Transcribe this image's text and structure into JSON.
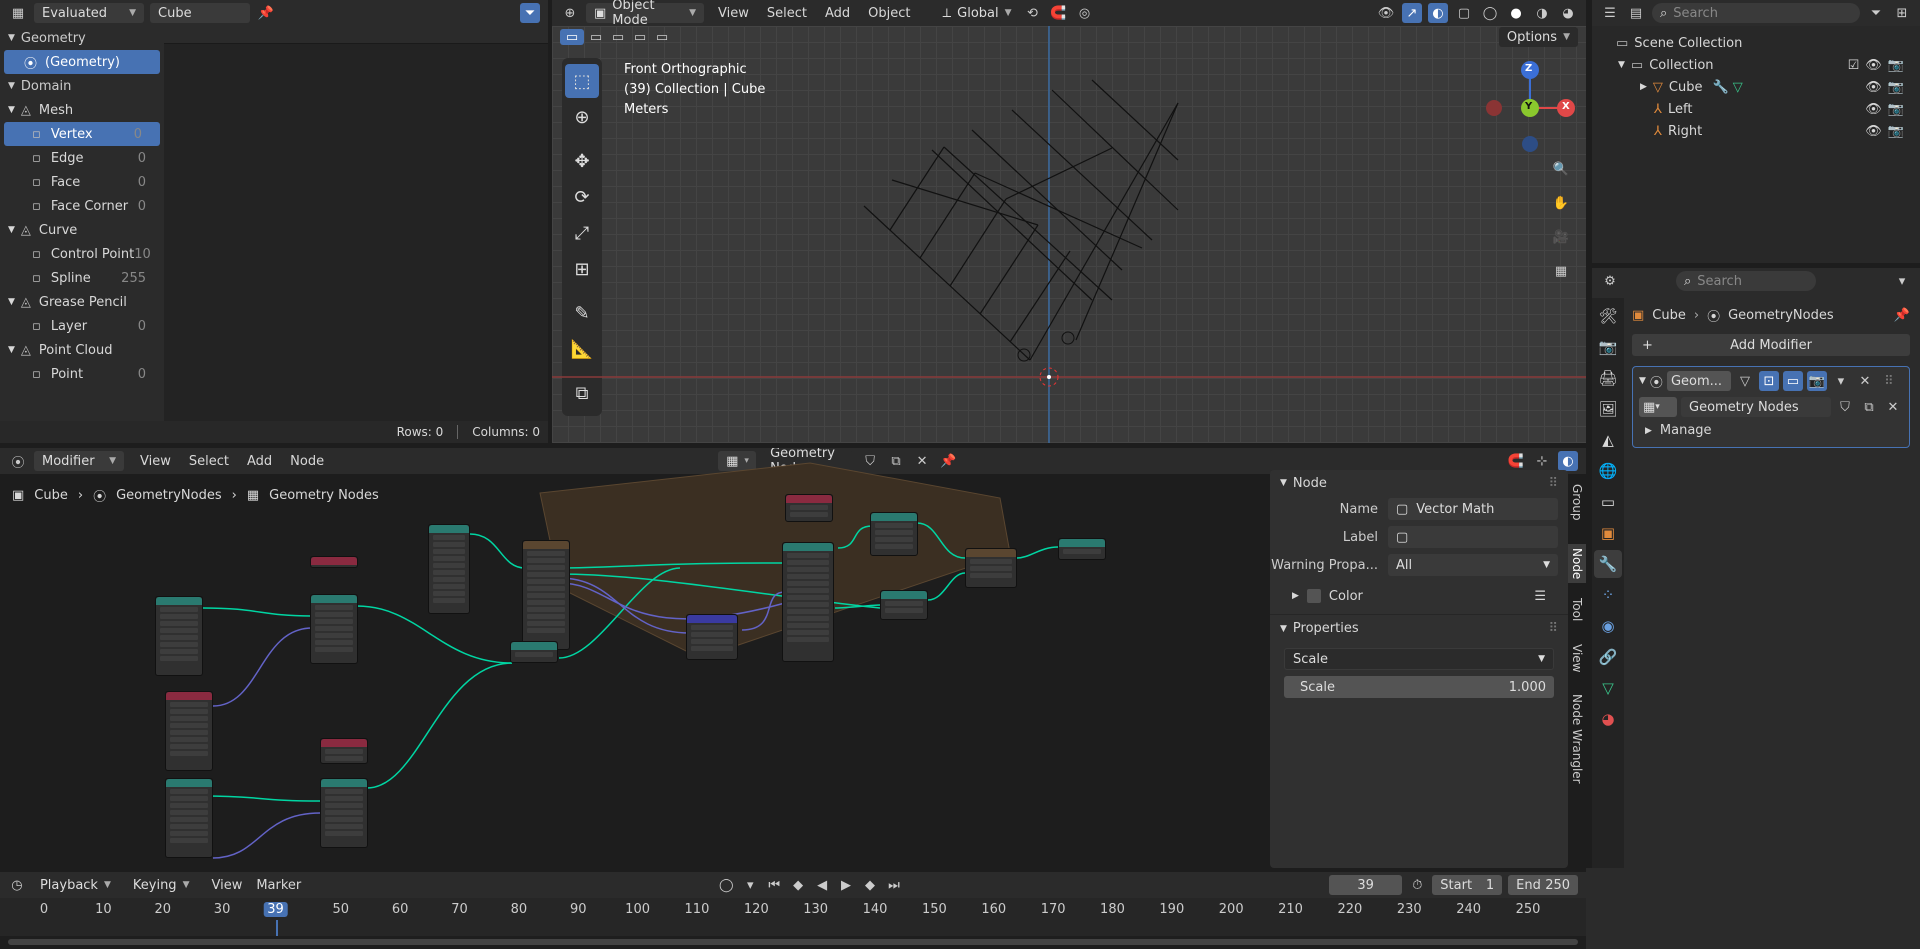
{
  "spreadsheet": {
    "mode": "Evaluated",
    "object": "Cube",
    "geometry_label": "Geometry",
    "geometry_item": "(Geometry)",
    "domain_label": "Domain",
    "groups": [
      {
        "name": "Mesh",
        "items": [
          {
            "label": "Vertex",
            "count": "0"
          },
          {
            "label": "Edge",
            "count": "0"
          },
          {
            "label": "Face",
            "count": "0"
          },
          {
            "label": "Face Corner",
            "count": "0"
          }
        ]
      },
      {
        "name": "Curve",
        "items": [
          {
            "label": "Control Point",
            "count": "10"
          },
          {
            "label": "Spline",
            "count": "255"
          }
        ]
      },
      {
        "name": "Grease Pencil",
        "items": [
          {
            "label": "Layer",
            "count": "0"
          }
        ]
      },
      {
        "name": "Point Cloud",
        "items": [
          {
            "label": "Point",
            "count": "0"
          }
        ]
      }
    ],
    "rows": "Rows: 0",
    "columns": "Columns: 0"
  },
  "viewport": {
    "mode": "Object Mode",
    "menu": [
      "View",
      "Select",
      "Add",
      "Object"
    ],
    "orientation": "Global",
    "options": "Options",
    "view_name": "Front Orthographic",
    "collection": "(39) Collection | Cube",
    "units": "Meters",
    "gizmo": {
      "z": "Z",
      "y": "Y",
      "x": "X"
    }
  },
  "outliner": {
    "search_placeholder": "Search",
    "scene": "Scene Collection",
    "collection": "Collection",
    "items": [
      "Cube",
      "Left",
      "Right"
    ]
  },
  "properties": {
    "search_placeholder": "Search",
    "breadcrumb": [
      "Cube",
      "GeometryNodes"
    ],
    "add_modifier": "Add Modifier",
    "modifier_short": "Geom...",
    "node_group": "Geometry Nodes",
    "manage": "Manage"
  },
  "node_editor": {
    "type": "Modifier",
    "menu": [
      "View",
      "Select",
      "Add",
      "Node"
    ],
    "tree": "Geometry Nodes",
    "breadcrumb": [
      "Cube",
      "GeometryNodes",
      "Geometry Nodes"
    ]
  },
  "npanel": {
    "node_header": "Node",
    "name_label": "Name",
    "name_value": "Vector Math",
    "label_label": "Label",
    "warning_label": "Warning Propa...",
    "warning_value": "All",
    "color_label": "Color",
    "properties_header": "Properties",
    "operation": "Scale",
    "scale_label": "Scale",
    "scale_value": "1.000",
    "tabs": [
      "Group",
      "Node",
      "Tool",
      "View",
      "Node Wrangler"
    ]
  },
  "timeline": {
    "menu": [
      "Playback",
      "Keying",
      "View",
      "Marker"
    ],
    "current": "39",
    "start_label": "Start",
    "start": "1",
    "end_label": "End",
    "end": "250",
    "ticks": [
      "0",
      "10",
      "20",
      "30",
      "39",
      "50",
      "60",
      "70",
      "80",
      "90",
      "100",
      "110",
      "120",
      "130",
      "140",
      "150",
      "160",
      "170",
      "180",
      "190",
      "200",
      "210",
      "220",
      "230",
      "240",
      "250"
    ]
  },
  "colors": {
    "accent": "#4772b3",
    "geometry_link": "#00d6a3",
    "vector_link": "#6363c7",
    "frame_box": "#3b2f22"
  }
}
